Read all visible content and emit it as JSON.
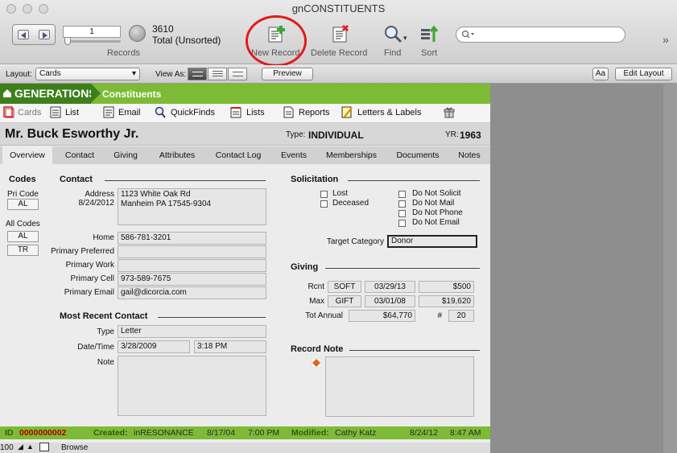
{
  "window": {
    "title": "gnCONSTITUENTS"
  },
  "toolbar": {
    "record_number": "1",
    "records_label": "Records",
    "total_count": "3610",
    "total_label": "Total (Unsorted)",
    "new_record_label": "New Record",
    "delete_record_label": "Delete Record",
    "find_label": "Find",
    "sort_label": "Sort",
    "search_placeholder": "",
    "overflow_glyph": "»"
  },
  "layout_bar": {
    "layout_label": "Layout:",
    "layout_value": "Cards",
    "view_as_label": "View As:",
    "preview_label": "Preview",
    "aa_label": "Aa",
    "edit_layout_label": "Edit Layout"
  },
  "brand": {
    "name": "GENERATIONS",
    "crumb": "Constituents"
  },
  "nav": {
    "cards": "Cards",
    "list": "List",
    "email": "Email",
    "quickfinds": "QuickFinds",
    "lists": "Lists",
    "reports": "Reports",
    "letters": "Letters & Labels"
  },
  "record": {
    "name": "Mr. Buck Esworthy Jr.",
    "type_label": "Type:",
    "type_value": "INDIVIDUAL",
    "yr_label": "YR:",
    "yr_value": "1963"
  },
  "tabs": [
    "Overview",
    "Contact",
    "Giving",
    "Attributes",
    "Contact Log",
    "Events",
    "Memberships",
    "Documents",
    "Notes"
  ],
  "codes": {
    "title": "Codes",
    "pri_label": "Pri Code",
    "pri_value": "AL",
    "all_label": "All Codes",
    "all_values": [
      "AL",
      "TR"
    ]
  },
  "contact": {
    "title": "Contact",
    "address_label": "Address",
    "address_date": "8/24/2012",
    "address_line1": "1123 White Oak Rd",
    "address_line2": "Manheim PA  17545-9304",
    "home_label": "Home",
    "home": "586-781-3201",
    "pref_label": "Primary Preferred",
    "pref": "",
    "work_label": "Primary Work",
    "work": "",
    "cell_label": "Primary Cell",
    "cell": "973-589-7675",
    "email_label": "Primary Email",
    "email": "gail@dicorcia.com"
  },
  "recent_contact": {
    "title": "Most Recent Contact",
    "type_label": "Type",
    "type": "Letter",
    "datetime_label": "Date/Time",
    "date": "3/28/2009",
    "time": "3:18 PM",
    "note_label": "Note",
    "note": ""
  },
  "solicitation": {
    "title": "Solicitation",
    "options_left": [
      "Lost",
      "Deceased"
    ],
    "options_right": [
      "Do Not Solicit",
      "Do Not Mail",
      "Do Not Phone",
      "Do Not Email"
    ],
    "target_label": "Target Category",
    "target_value": "Donor"
  },
  "giving": {
    "title": "Giving",
    "rcnt_label": "Rcnt",
    "rcnt_type": "SOFT",
    "rcnt_date": "03/29/13",
    "rcnt_amount": "$500",
    "max_label": "Max",
    "max_type": "GIFT",
    "max_date": "03/01/08",
    "max_amount": "$19,620",
    "tot_label": "Tot Annual",
    "tot_amount": "$64,770",
    "count_label": "#",
    "count": "20"
  },
  "record_note": {
    "title": "Record Note",
    "text": ""
  },
  "status": {
    "id_label": "ID",
    "id_value": "0000000002",
    "created_label": "Created:",
    "created_by": "inRESONANCE",
    "created_date": "8/17/04",
    "created_time": "7:00 PM",
    "modified_label": "Modified:",
    "modified_by": "Cathy Katz",
    "modified_date": "8/24/12",
    "modified_time": "8:47 AM"
  },
  "bottom": {
    "zoom": "100",
    "mode": "Browse"
  },
  "colors": {
    "green_bar": "#7dbb36",
    "brand_dark": "#3d7f1b",
    "highlight_circle": "#e31a1a",
    "id_text": "#b10000"
  }
}
